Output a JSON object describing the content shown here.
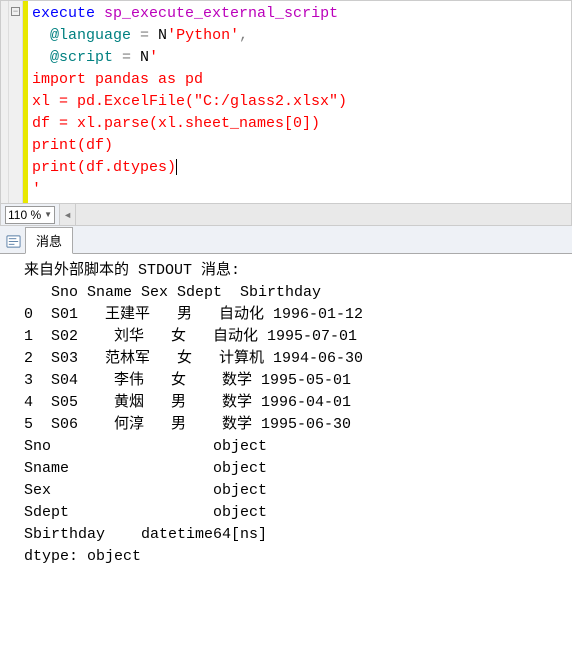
{
  "code": {
    "l1": {
      "exec": "execute",
      "sp": "sp_execute_external_script"
    },
    "l2": {
      "at": "@language",
      "eq": " = ",
      "n": "N",
      "lit": "'Python'",
      "comma": ","
    },
    "l3": {
      "at": "@script",
      "eq": " = ",
      "n": "N",
      "q": "'"
    },
    "l4": "import pandas as pd",
    "l5": "xl = pd.ExcelFile(\"C:/glass2.xlsx\")",
    "l6": "df = xl.parse(xl.sheet_names[0])",
    "l7": "print(df)",
    "l8": "print(df.dtypes)",
    "l9": "'"
  },
  "zoom": {
    "level": "110 %"
  },
  "tab": {
    "label": "消息"
  },
  "output": {
    "header": "来自外部脚本的 STDOUT 消息:",
    "cols": "   Sno Sname Sex Sdept  Sbirthday",
    "rows": [
      "0  S01   王建平   男   自动化 1996-01-12",
      "1  S02    刘华   女   自动化 1995-07-01",
      "2  S03   范林军   女   计算机 1994-06-30",
      "3  S04    李伟   女    数学 1995-05-01",
      "4  S05    黄烟   男    数学 1996-04-01",
      "5  S06    何淳   男    数学 1995-06-30"
    ],
    "dtypes": [
      "Sno                  object",
      "Sname                object",
      "Sex                  object",
      "Sdept                object",
      "Sbirthday    datetime64[ns]",
      "dtype: object"
    ]
  }
}
